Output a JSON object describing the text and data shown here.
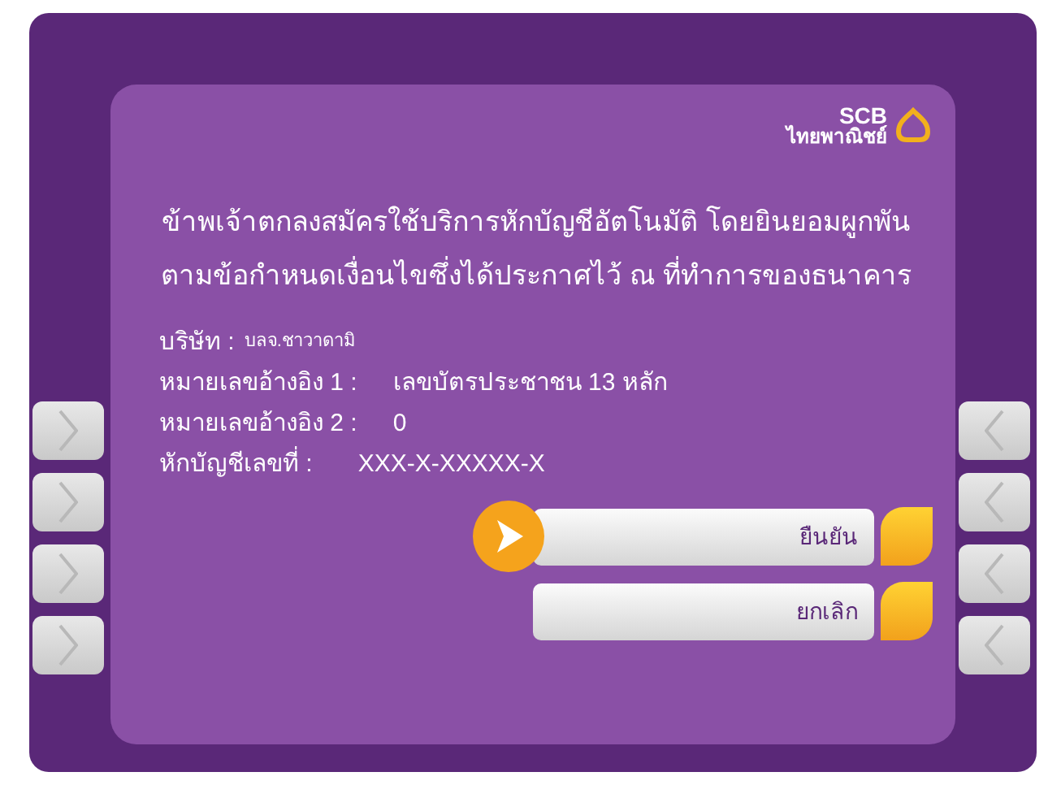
{
  "logo": {
    "brand": "SCB",
    "name": "ไทยพาณิชย์"
  },
  "message": [
    "ข้าพเจ้าตกลงสมัครใช้บริการหักบัญชีอัตโนมัติ โดยยินยอมผูกพัน",
    "ตามข้อกำหนดเงื่อนไขซึ่งได้ประกาศไว้ ณ ที่ทำการของธนาคาร"
  ],
  "fields": [
    {
      "label": "บริษัท :",
      "value": "บลจ.ชาวาดามิ",
      "kind": "inline"
    },
    {
      "label": "หมายเลขอ้างอิง 1 :",
      "value": "เลขบัตรประชาชน 13 หลัก",
      "kind": "column"
    },
    {
      "label": "หมายเลขอ้างอิง 2 :",
      "value": "0",
      "kind": "column"
    },
    {
      "label": "หักบัญชีเลขที่ :",
      "value": "XXX-X-XXXXX-X",
      "kind": "wide"
    }
  ],
  "options": [
    {
      "label": "ยืนยัน",
      "selected": true
    },
    {
      "label": "ยกเลิก",
      "selected": false
    }
  ]
}
